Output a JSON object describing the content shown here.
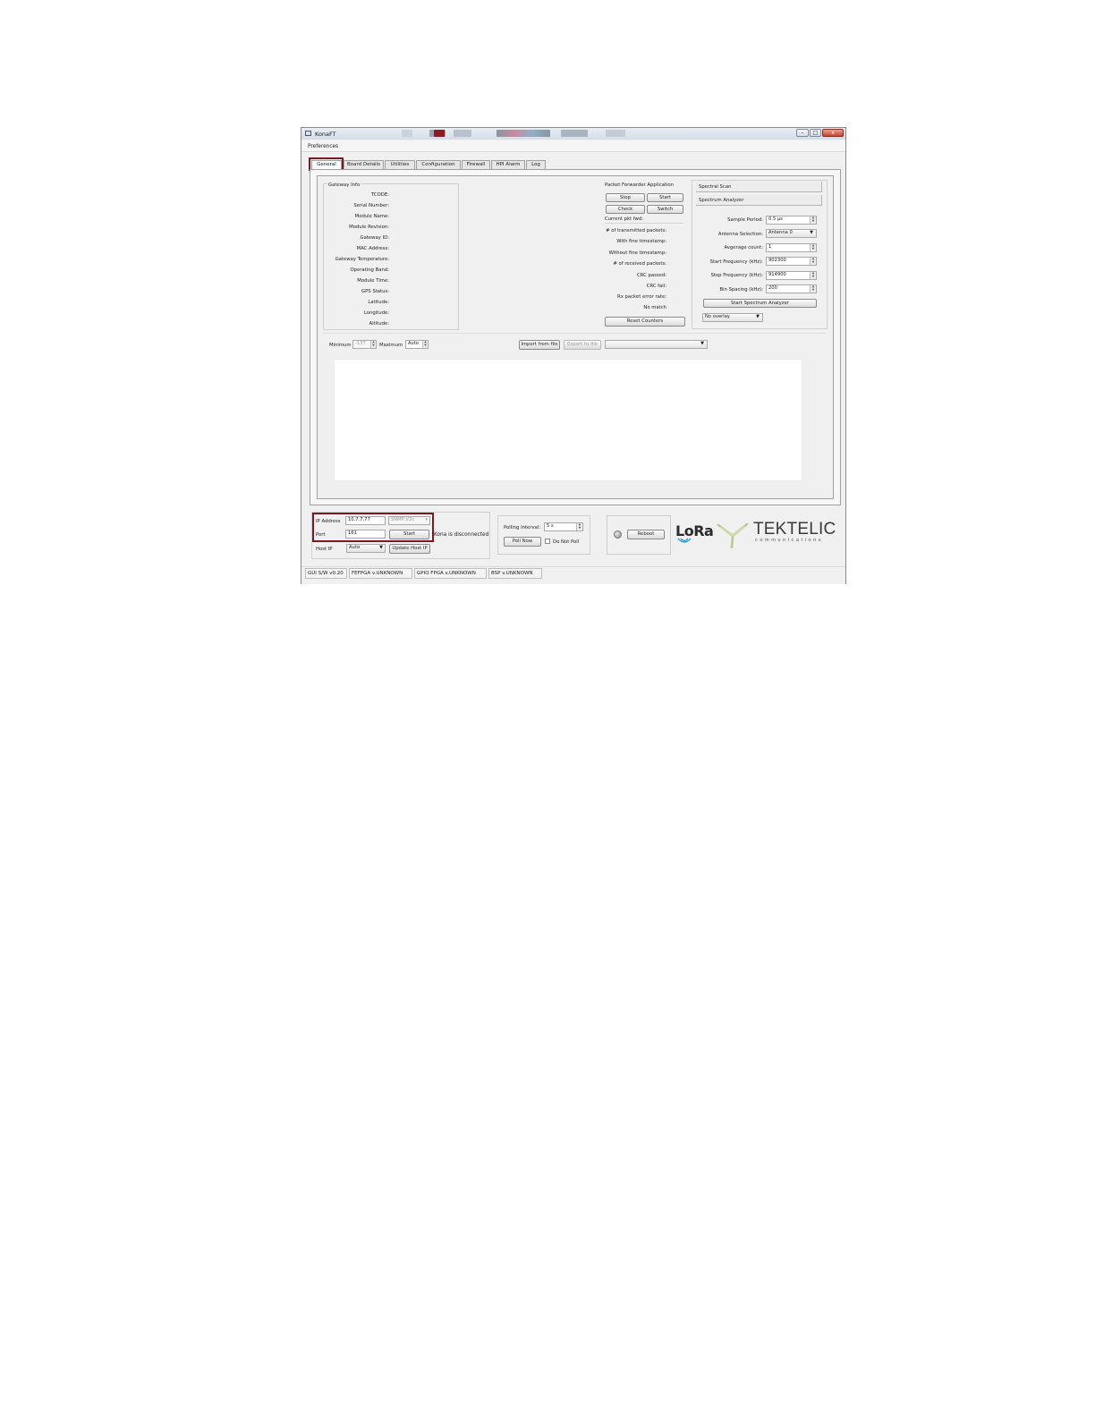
{
  "window": {
    "title": "KonaFT",
    "minimize": "–",
    "maximize": "□",
    "close": "x"
  },
  "menu": {
    "preferences": "Preferences"
  },
  "tabs": [
    "General",
    "Board Details",
    "Utilities",
    "Configuration",
    "Firewall",
    "HPI Alarm",
    "Log"
  ],
  "gateway_info": {
    "title": "Gateway Info",
    "labels": [
      "TCODE:",
      "Serial Number:",
      "Module Name:",
      "Module Revision:",
      "Gateway ID:",
      "MAC Address:",
      "Gateway Temperature:",
      "Operating Band:",
      "Module Time:",
      "GPS Status:",
      "Latitude:",
      "Longitude:",
      "Altitude:"
    ]
  },
  "packet_forwarder": {
    "title": "Packet Forwarder Application",
    "stop": "Stop",
    "start": "Start",
    "check": "Check",
    "switch": "Switch",
    "current": "Current pkt fwd:",
    "labels": [
      "# of transmitted packets:",
      "With fine timestamp:",
      "Without fine timestamp:",
      "# of received packets:",
      "CRC passed:",
      "CRC fail:",
      "Rx packet error rate:",
      "No match"
    ],
    "reset": "Reset Counters"
  },
  "spectral": {
    "scan": "Spectral Scan",
    "analyzer": "Spectrum Analyzer",
    "sample_period_label": "Sample Period:",
    "sample_period": "0.5 µs",
    "antenna_label": "Antenna Selection:",
    "antenna": "Antenna 0",
    "avg_label": "Avgerage count:",
    "avg": "1",
    "start_freq_label": "Start Frequency (kHz):",
    "start_freq": "902300",
    "stop_freq_label": "Stop Frequency (kHz):",
    "stop_freq": "914900",
    "bin_label": "Bin Spacing (kHz):",
    "bin": "200",
    "start_btn": "Start Spectrum Analyzer",
    "overlay": "No overlay"
  },
  "plot_controls": {
    "minimum_label": "Minimum",
    "minimum": "-137",
    "maximum_label": "Maximum",
    "maximum": "Auto",
    "import": "Import from file",
    "export": "Export to file"
  },
  "connection": {
    "ip_label": "IP Address",
    "ip": "10.7.7.77",
    "snmp": "SNMP V2c",
    "port_label": "Port",
    "port": "161",
    "start": "Start",
    "status": "Kona is disconnected",
    "host_ip_label": "Host IP",
    "host_ip": "Auto",
    "update_host": "Update Host IP"
  },
  "polling": {
    "label": "Polling Interval:",
    "value": "5 s",
    "poll_now": "Poll Now",
    "do_not_poll": "Do Not Poll"
  },
  "reboot": "Reboot",
  "logos": {
    "lora": "LoRa",
    "tektelic": "TEKTELIC",
    "tektelic_sub": "communications"
  },
  "status_bar": [
    "GUI S/W v0.20",
    "FEFPGA v.UNKNOWN",
    "GPIO FPGA v.UNKNOWN",
    "BSP v.UNKNOWN"
  ]
}
